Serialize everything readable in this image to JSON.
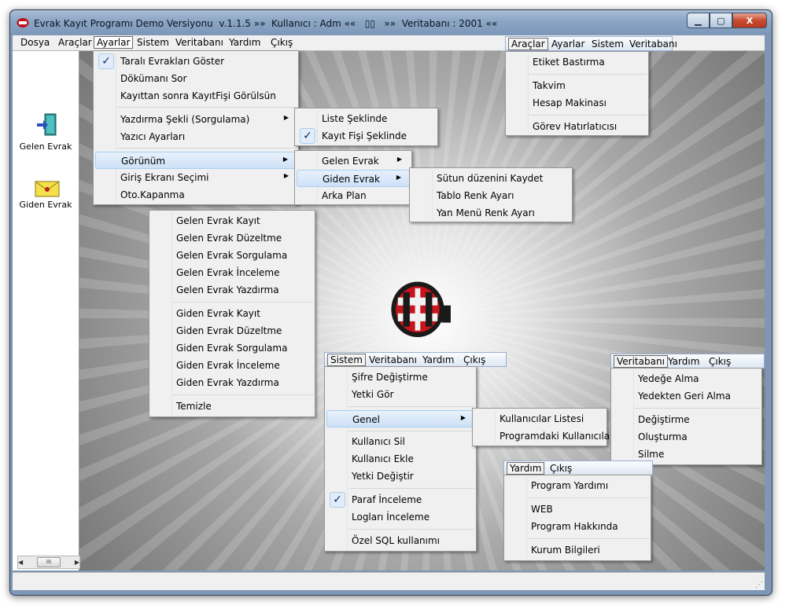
{
  "window": {
    "title": "Evrak Kayıt Programı Demo Versiyonu  v.1.1.5 »»  Kullanıcı : Adm ««   ▯▯   »»  Veritabanı : 2001 ««",
    "buttons": {
      "minimize": "▁",
      "maximize": "▢",
      "close": "X"
    }
  },
  "menubar": {
    "items": [
      "Dosya",
      "Araçlar",
      "Ayarlar",
      "Sistem",
      "Veritabanı",
      "Yardım",
      "Çıkış"
    ]
  },
  "sidebar": {
    "items": [
      {
        "label": "Gelen Evrak",
        "icon": "door-enter-icon"
      },
      {
        "label": "Giden Evrak",
        "icon": "envelope-icon"
      }
    ],
    "scroll_thumb": "III"
  },
  "ayarlar_menu": {
    "items": [
      "Taralı Evrakları Göster",
      "Dökümanı Sor",
      "Kayıttan sonra KayıtFişi Görülsün",
      "Yazdırma Şekli (Sorgulama)",
      "Yazıcı Ayarları",
      "Görünüm",
      "Giriş Ekranı Seçimi",
      "Oto.Kapanma"
    ],
    "check": "✓"
  },
  "yazdirma_submenu": {
    "items": [
      "Liste Şeklinde",
      "Kayıt Fişi Şeklinde"
    ]
  },
  "gorunum_submenu": {
    "items": [
      "Gelen Evrak",
      "Giden Evrak",
      "Arka Plan"
    ]
  },
  "giden_submenu": {
    "items": [
      "Sütun düzenini Kaydet",
      "Tablo Renk Ayarı",
      "Yan Menü Renk Ayarı"
    ]
  },
  "giris_ekrani_menu": {
    "items": [
      "Gelen Evrak Kayıt",
      "Gelen Evrak Düzeltme",
      "Gelen Evrak Sorgulama",
      "Gelen Evrak İnceleme",
      "Gelen Evrak Yazdırma",
      "Giden Evrak Kayıt",
      "Giden Evrak Düzeltme",
      "Giden Evrak Sorgulama",
      "Giden Evrak İnceleme",
      "Giden Evrak Yazdırma",
      "Temizle"
    ]
  },
  "araclar_bar": {
    "items": [
      "Araçlar",
      "Ayarlar",
      "Sistem",
      "Veritabanı"
    ]
  },
  "araclar_menu": {
    "items": [
      "Etiket Bastırma",
      "Takvim",
      "Hesap Makinası",
      "Görev Hatırlatıcısı"
    ]
  },
  "sistem_bar": {
    "items": [
      "Sistem",
      "Veritabanı",
      "Yardım",
      "Çıkış"
    ]
  },
  "sistem_menu": {
    "items": [
      "Şifre Değiştirme",
      "Yetki Gör",
      "Genel",
      "Kullanıcı Sil",
      "Kullanıcı Ekle",
      "Yetki Değiştir",
      "Paraf İnceleme",
      "Logları İnceleme",
      "Özel SQL  kullanımı"
    ]
  },
  "genel_submenu": {
    "items": [
      "Kullanıcılar Listesi",
      "Programdaki Kullanıcılar"
    ]
  },
  "veritabani_bar": {
    "items": [
      "Veritabanı",
      "Yardım",
      "Çıkış"
    ]
  },
  "veritabani_menu": {
    "items": [
      "Yedeğe Alma",
      "Yedekten Geri Alma",
      "Değiştirme",
      "Oluşturma",
      "Silme"
    ]
  },
  "yardim_bar": {
    "items": [
      "Yardım",
      "Çıkış"
    ]
  },
  "yardim_menu": {
    "items": [
      "Program Yardımı",
      "WEB",
      "Program Hakkında",
      "Kurum Bilgileri"
    ]
  }
}
